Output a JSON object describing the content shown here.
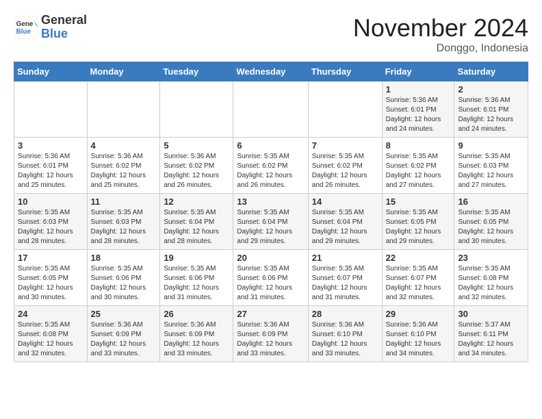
{
  "logo": {
    "general": "General",
    "blue": "Blue"
  },
  "header": {
    "month": "November 2024",
    "location": "Donggo, Indonesia"
  },
  "weekdays": [
    "Sunday",
    "Monday",
    "Tuesday",
    "Wednesday",
    "Thursday",
    "Friday",
    "Saturday"
  ],
  "weeks": [
    [
      {
        "day": "",
        "info": ""
      },
      {
        "day": "",
        "info": ""
      },
      {
        "day": "",
        "info": ""
      },
      {
        "day": "",
        "info": ""
      },
      {
        "day": "",
        "info": ""
      },
      {
        "day": "1",
        "info": "Sunrise: 5:36 AM\nSunset: 6:01 PM\nDaylight: 12 hours and 24 minutes."
      },
      {
        "day": "2",
        "info": "Sunrise: 5:36 AM\nSunset: 6:01 PM\nDaylight: 12 hours and 24 minutes."
      }
    ],
    [
      {
        "day": "3",
        "info": "Sunrise: 5:36 AM\nSunset: 6:01 PM\nDaylight: 12 hours and 25 minutes."
      },
      {
        "day": "4",
        "info": "Sunrise: 5:36 AM\nSunset: 6:02 PM\nDaylight: 12 hours and 25 minutes."
      },
      {
        "day": "5",
        "info": "Sunrise: 5:36 AM\nSunset: 6:02 PM\nDaylight: 12 hours and 26 minutes."
      },
      {
        "day": "6",
        "info": "Sunrise: 5:35 AM\nSunset: 6:02 PM\nDaylight: 12 hours and 26 minutes."
      },
      {
        "day": "7",
        "info": "Sunrise: 5:35 AM\nSunset: 6:02 PM\nDaylight: 12 hours and 26 minutes."
      },
      {
        "day": "8",
        "info": "Sunrise: 5:35 AM\nSunset: 6:02 PM\nDaylight: 12 hours and 27 minutes."
      },
      {
        "day": "9",
        "info": "Sunrise: 5:35 AM\nSunset: 6:03 PM\nDaylight: 12 hours and 27 minutes."
      }
    ],
    [
      {
        "day": "10",
        "info": "Sunrise: 5:35 AM\nSunset: 6:03 PM\nDaylight: 12 hours and 28 minutes."
      },
      {
        "day": "11",
        "info": "Sunrise: 5:35 AM\nSunset: 6:03 PM\nDaylight: 12 hours and 28 minutes."
      },
      {
        "day": "12",
        "info": "Sunrise: 5:35 AM\nSunset: 6:04 PM\nDaylight: 12 hours and 28 minutes."
      },
      {
        "day": "13",
        "info": "Sunrise: 5:35 AM\nSunset: 6:04 PM\nDaylight: 12 hours and 29 minutes."
      },
      {
        "day": "14",
        "info": "Sunrise: 5:35 AM\nSunset: 6:04 PM\nDaylight: 12 hours and 29 minutes."
      },
      {
        "day": "15",
        "info": "Sunrise: 5:35 AM\nSunset: 6:05 PM\nDaylight: 12 hours and 29 minutes."
      },
      {
        "day": "16",
        "info": "Sunrise: 5:35 AM\nSunset: 6:05 PM\nDaylight: 12 hours and 30 minutes."
      }
    ],
    [
      {
        "day": "17",
        "info": "Sunrise: 5:35 AM\nSunset: 6:05 PM\nDaylight: 12 hours and 30 minutes."
      },
      {
        "day": "18",
        "info": "Sunrise: 5:35 AM\nSunset: 6:06 PM\nDaylight: 12 hours and 30 minutes."
      },
      {
        "day": "19",
        "info": "Sunrise: 5:35 AM\nSunset: 6:06 PM\nDaylight: 12 hours and 31 minutes."
      },
      {
        "day": "20",
        "info": "Sunrise: 5:35 AM\nSunset: 6:06 PM\nDaylight: 12 hours and 31 minutes."
      },
      {
        "day": "21",
        "info": "Sunrise: 5:35 AM\nSunset: 6:07 PM\nDaylight: 12 hours and 31 minutes."
      },
      {
        "day": "22",
        "info": "Sunrise: 5:35 AM\nSunset: 6:07 PM\nDaylight: 12 hours and 32 minutes."
      },
      {
        "day": "23",
        "info": "Sunrise: 5:35 AM\nSunset: 6:08 PM\nDaylight: 12 hours and 32 minutes."
      }
    ],
    [
      {
        "day": "24",
        "info": "Sunrise: 5:35 AM\nSunset: 6:08 PM\nDaylight: 12 hours and 32 minutes."
      },
      {
        "day": "25",
        "info": "Sunrise: 5:36 AM\nSunset: 6:09 PM\nDaylight: 12 hours and 33 minutes."
      },
      {
        "day": "26",
        "info": "Sunrise: 5:36 AM\nSunset: 6:09 PM\nDaylight: 12 hours and 33 minutes."
      },
      {
        "day": "27",
        "info": "Sunrise: 5:36 AM\nSunset: 6:09 PM\nDaylight: 12 hours and 33 minutes."
      },
      {
        "day": "28",
        "info": "Sunrise: 5:36 AM\nSunset: 6:10 PM\nDaylight: 12 hours and 33 minutes."
      },
      {
        "day": "29",
        "info": "Sunrise: 5:36 AM\nSunset: 6:10 PM\nDaylight: 12 hours and 34 minutes."
      },
      {
        "day": "30",
        "info": "Sunrise: 5:37 AM\nSunset: 6:11 PM\nDaylight: 12 hours and 34 minutes."
      }
    ]
  ]
}
